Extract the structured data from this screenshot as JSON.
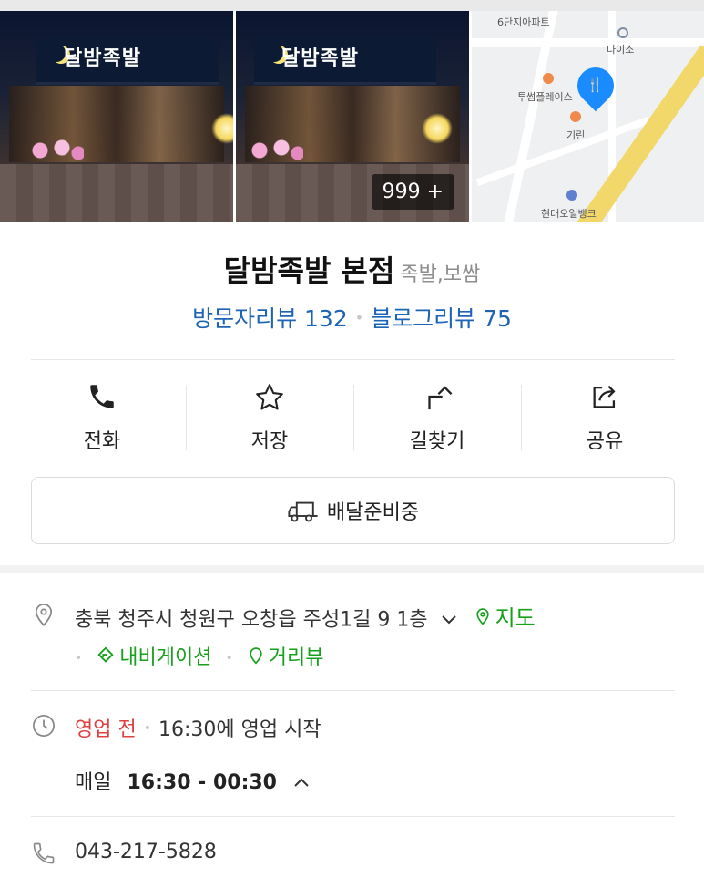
{
  "photos": {
    "store_sign": "달밤족발",
    "photo_count": "999 +"
  },
  "map": {
    "labels": {
      "apartment": "6단지아파트",
      "daiso": "다이소",
      "twosome": "투썸플레이스",
      "kirin": "기린",
      "oilbank": "현대오일뱅크"
    }
  },
  "place": {
    "name": "달밤족발 본점",
    "category": "족발,보쌈",
    "visitor_reviews": "방문자리뷰 132",
    "blog_reviews": "블로그리뷰 75"
  },
  "actions": [
    {
      "label": "전화",
      "icon": "phone-icon"
    },
    {
      "label": "저장",
      "icon": "star-icon"
    },
    {
      "label": "길찾기",
      "icon": "directions-icon"
    },
    {
      "label": "공유",
      "icon": "share-icon"
    }
  ],
  "delivery": {
    "label": "배달준비중",
    "icon": "delivery-truck-icon"
  },
  "address": {
    "text": "충북 청주시 청원구 오창읍 주성1길 9 1층",
    "map_link": "지도",
    "navigation_link": "내비게이션",
    "street_view_link": "거리뷰"
  },
  "hours": {
    "status": "영업 전",
    "next_open": "16:30에 영업 시작",
    "day_label": "매일",
    "range": "16:30 - 00:30"
  },
  "phone": {
    "number": "043-217-5828"
  },
  "colors": {
    "link_blue": "#1e64b4",
    "green": "#17a11b",
    "red": "#e04040",
    "pin_blue": "#1a8cff"
  }
}
